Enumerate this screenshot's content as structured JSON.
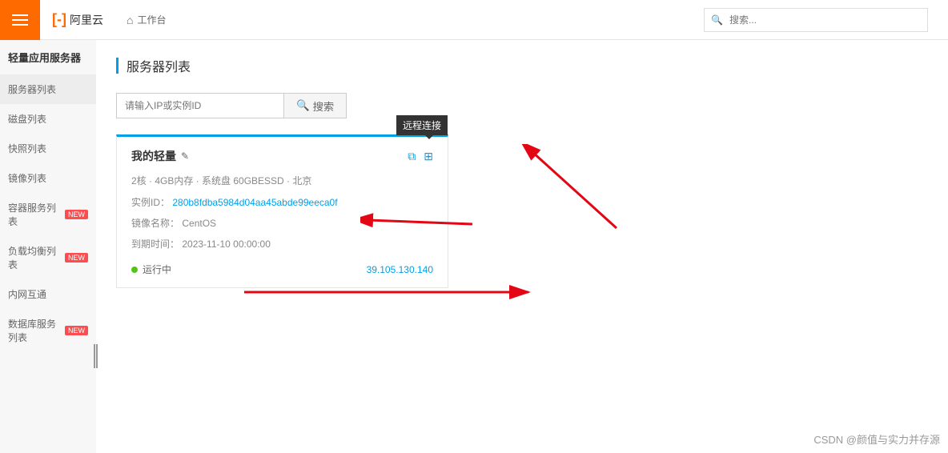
{
  "header": {
    "brand": "阿里云",
    "workspace_label": "工作台",
    "search_placeholder": "搜索..."
  },
  "sidebar": {
    "title": "轻量应用服务器",
    "items": [
      {
        "label": "服务器列表",
        "badge": ""
      },
      {
        "label": "磁盘列表",
        "badge": ""
      },
      {
        "label": "快照列表",
        "badge": ""
      },
      {
        "label": "镜像列表",
        "badge": ""
      },
      {
        "label": "容器服务列表",
        "badge": "NEW"
      },
      {
        "label": "负载均衡列表",
        "badge": "NEW"
      },
      {
        "label": "内网互通",
        "badge": ""
      },
      {
        "label": "数据库服务列表",
        "badge": "NEW"
      }
    ]
  },
  "page": {
    "title": "服务器列表",
    "search_placeholder": "请输入IP或实例ID",
    "search_button": "搜索"
  },
  "tooltip": "远程连接",
  "server": {
    "name": "我的轻量",
    "spec": "2核 · 4GB内存 · 系统盘  60GBESSD · 北京",
    "instance_label": "实例ID：",
    "instance_id": "280b8fdba5984d04aa45abde99eeca0f",
    "image_label": "镜像名称：",
    "image_name": "CentOS",
    "expire_label": "到期时间：",
    "expire_time": "2023-11-10 00:00:00",
    "status": "运行中",
    "ip": "39.105.130.140"
  },
  "watermark": "CSDN @颜值与实力并存源"
}
